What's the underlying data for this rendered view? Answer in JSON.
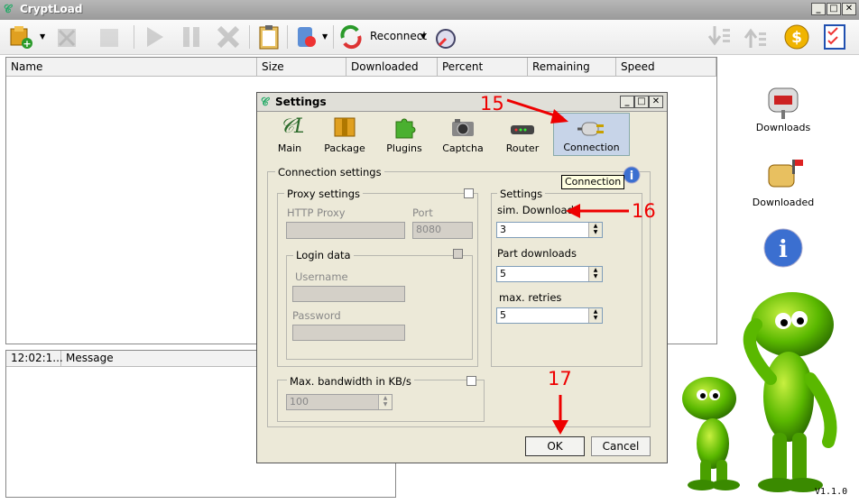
{
  "app": {
    "title": "CryptLoad",
    "version": "V1.1.0"
  },
  "toolbar": {
    "reconnect_label": "Reconnect"
  },
  "grid": {
    "columns": [
      "Name",
      "Size",
      "Downloaded",
      "Percent",
      "Remaining",
      "Speed"
    ]
  },
  "log": {
    "columns": [
      "12:02:1...",
      "Message"
    ]
  },
  "sidebar": {
    "items": [
      {
        "label": "Downloads"
      },
      {
        "label": "Downloaded"
      }
    ]
  },
  "settings": {
    "title": "Settings",
    "tabs": [
      {
        "label": "Main"
      },
      {
        "label": "Package"
      },
      {
        "label": "Plugins"
      },
      {
        "label": "Captcha"
      },
      {
        "label": "Router"
      },
      {
        "label": "Connection"
      }
    ],
    "tooltip": "Connection",
    "connection_group": "Connection settings",
    "proxy": {
      "group": "Proxy settings",
      "http_label": "HTTP Proxy",
      "http_value": "",
      "port_label": "Port",
      "port_value": "8080"
    },
    "login": {
      "group": "Login data",
      "username_label": "Username",
      "password_label": "Password"
    },
    "bandwidth": {
      "group": "Max. bandwidth in KB/s",
      "value": "100"
    },
    "downloads": {
      "group": "Settings",
      "sim_label": "sim. Downloads",
      "sim_value": "3",
      "part_label": "Part downloads",
      "part_value": "5",
      "retries_label": "max. retries",
      "retries_value": "5"
    },
    "ok_label": "OK",
    "cancel_label": "Cancel"
  },
  "annotations": {
    "a15": "15",
    "a16": "16",
    "a17": "17"
  },
  "colors": {
    "annotation": "#ee0000",
    "selected_tab": "#c7d4e8"
  }
}
